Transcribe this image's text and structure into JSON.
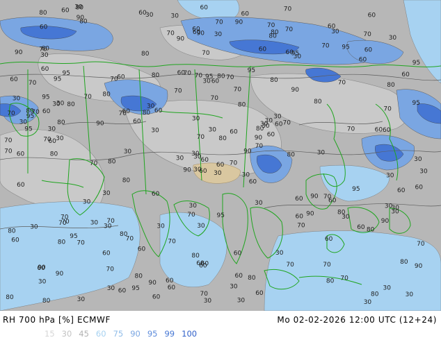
{
  "header": {
    "title": "RH 700 hPa [%] ECMWF",
    "datetime": "Mo 02-02-2026 12:00 UTC (12+24)"
  },
  "legend": [
    {
      "label": "15",
      "color": "#d6d6d6"
    },
    {
      "label": "30",
      "color": "#c4c4c4"
    },
    {
      "label": "45",
      "color": "#b2b2b2"
    },
    {
      "label": "60",
      "color": "#a7d2f1"
    },
    {
      "label": "75",
      "color": "#90bde9"
    },
    {
      "label": "90",
      "color": "#7aa6e2"
    },
    {
      "label": "95",
      "color": "#5e8cdc"
    },
    {
      "label": "99",
      "color": "#4677d4"
    },
    {
      "label": "100",
      "color": "#2f5fc9"
    }
  ],
  "map": {
    "background_color": "#b7b7b7",
    "border_color": "#1fa51f",
    "contour_labels": [
      "30",
      "95",
      "30",
      "90",
      "80",
      "70",
      "70",
      "80",
      "95",
      "90",
      "80",
      "30",
      "30",
      "95",
      "90",
      "90",
      "30",
      "70",
      "80",
      "95",
      "60",
      "30",
      "70",
      "95",
      "30",
      "60",
      "95",
      "90",
      "95",
      "60",
      "95",
      "30",
      "80",
      "70",
      "60",
      "70",
      "80",
      "80",
      "80",
      "70",
      "60",
      "80",
      "90",
      "70",
      "60",
      "70",
      "90",
      "80",
      "60",
      "70",
      "80",
      "80",
      "90",
      "90",
      "70",
      "60",
      "90",
      "80",
      "60",
      "60",
      "70",
      "30",
      "70",
      "80",
      "95",
      "30",
      "80",
      "90",
      "30",
      "80",
      "30",
      "90",
      "90",
      "70",
      "60",
      "60",
      "70",
      "60",
      "30",
      "60",
      "60",
      "90",
      "80",
      "30",
      "70",
      "60",
      "95",
      "70",
      "30",
      "30",
      "60",
      "30",
      "70",
      "60",
      "80",
      "90",
      "95",
      "30",
      "60",
      "30",
      "70",
      "60",
      "30",
      "30",
      "30",
      "30",
      "80",
      "30",
      "60",
      "30",
      "30",
      "30",
      "60",
      "30",
      "30",
      "30",
      "60",
      "30",
      "60",
      "30",
      "70",
      "60",
      "70",
      "80",
      "30",
      "30",
      "30",
      "60",
      "70",
      "60",
      "70",
      "60",
      "60",
      "80",
      "60",
      "30",
      "80",
      "70",
      "60",
      "30",
      "30",
      "80",
      "60",
      "70",
      "30",
      "60",
      "60",
      "80",
      "60",
      "60",
      "70",
      "70",
      "80",
      "60",
      "95",
      "90",
      "70",
      "70",
      "80",
      "95",
      "30",
      "30",
      "70",
      "60",
      "80",
      "95",
      "30",
      "90",
      "80",
      "30",
      "80",
      "80",
      "30",
      "70",
      "30",
      "95",
      "60",
      "60",
      "60",
      "30",
      "70",
      "60",
      "30",
      "60",
      "70",
      "80",
      "30",
      "30",
      "60",
      "60",
      "30",
      "30",
      "30",
      "70",
      "60",
      "60",
      "80",
      "70",
      "80",
      "30",
      "60",
      "60",
      "70",
      "70",
      "80",
      "60",
      "30",
      "60",
      "70",
      "30",
      "70",
      "60",
      "60",
      "30",
      "60",
      "70",
      "70",
      "60",
      "60",
      "70",
      "70",
      "70",
      "80",
      "80",
      "30",
      "70",
      "60",
      "70",
      "60",
      "70",
      "70"
    ]
  }
}
